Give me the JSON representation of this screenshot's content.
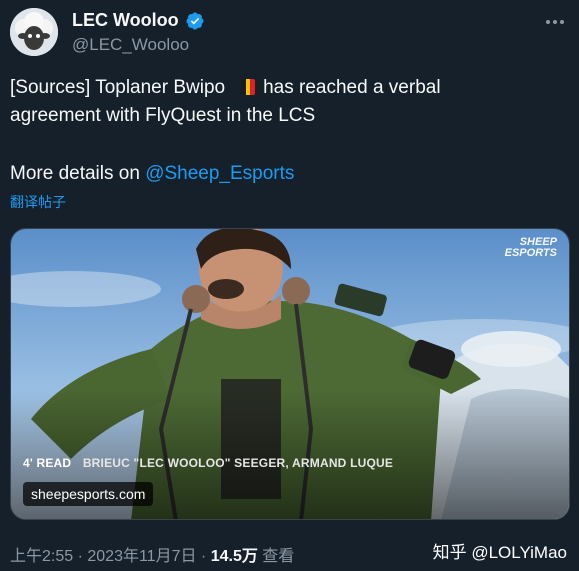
{
  "author": {
    "display_name": "LEC Wooloo",
    "handle": "@LEC_Wooloo",
    "verified": true
  },
  "tweet": {
    "line1_pre": "[Sources] Toplaner Bwipo",
    "line1_post": "has reached a verbal",
    "line2": "agreement with FlyQuest in the LCS",
    "line3_pre": "More details on ",
    "mention": "@Sheep_Esports",
    "flag_colors": [
      "#1a1a1a",
      "#f5c400",
      "#e1202b"
    ],
    "translate_label": "翻译帖子"
  },
  "card": {
    "brand_line1": "SHEEP",
    "brand_line2": "ESPORTS",
    "read_time": "4' READ",
    "authors": "BRIEUC \"LEC WOOLOO\" SEEGER, ARMAND LUQUE",
    "domain": "sheepesports.com"
  },
  "footer": {
    "time": "上午2:55",
    "separator1": " · ",
    "date": "2023年11月7日",
    "separator2": " · ",
    "views": "14.5万",
    "views_label": " 查看"
  },
  "watermark": "知乎 @LOLYiMao",
  "colors": {
    "background": "#15202b",
    "accent": "#1d9bf0",
    "secondary_text": "#8b98a5"
  }
}
